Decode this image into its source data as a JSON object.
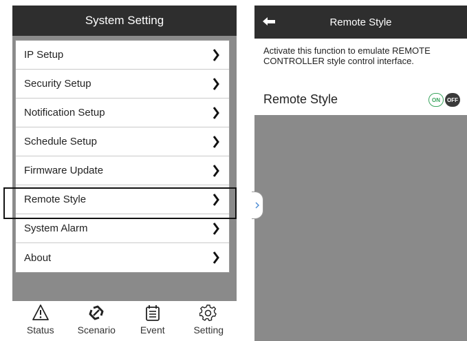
{
  "left_screen": {
    "title": "System Setting",
    "menu": [
      {
        "label": "IP Setup"
      },
      {
        "label": "Security Setup"
      },
      {
        "label": "Notification Setup"
      },
      {
        "label": "Schedule Setup"
      },
      {
        "label": "Firmware Update"
      },
      {
        "label": "Remote Style"
      },
      {
        "label": "System Alarm"
      },
      {
        "label": "About"
      }
    ],
    "highlighted_item": "Remote Style",
    "tabs": [
      {
        "label": "Status",
        "icon": "warning-icon"
      },
      {
        "label": "Scenario",
        "icon": "scenario-icon"
      },
      {
        "label": "Event",
        "icon": "calendar-icon"
      },
      {
        "label": "Setting",
        "icon": "gear-icon"
      }
    ]
  },
  "right_screen": {
    "title": "Remote Style",
    "description": "Activate this function to emulate REMOTE CONTROLLER style control interface.",
    "setting_label": "Remote Style",
    "toggle": {
      "on_label": "ON",
      "off_label": "OFF",
      "state": "OFF"
    }
  },
  "colors": {
    "header": "#2e2e2e",
    "background": "#8a8a8a",
    "toggle_on": "#3aa55e"
  }
}
